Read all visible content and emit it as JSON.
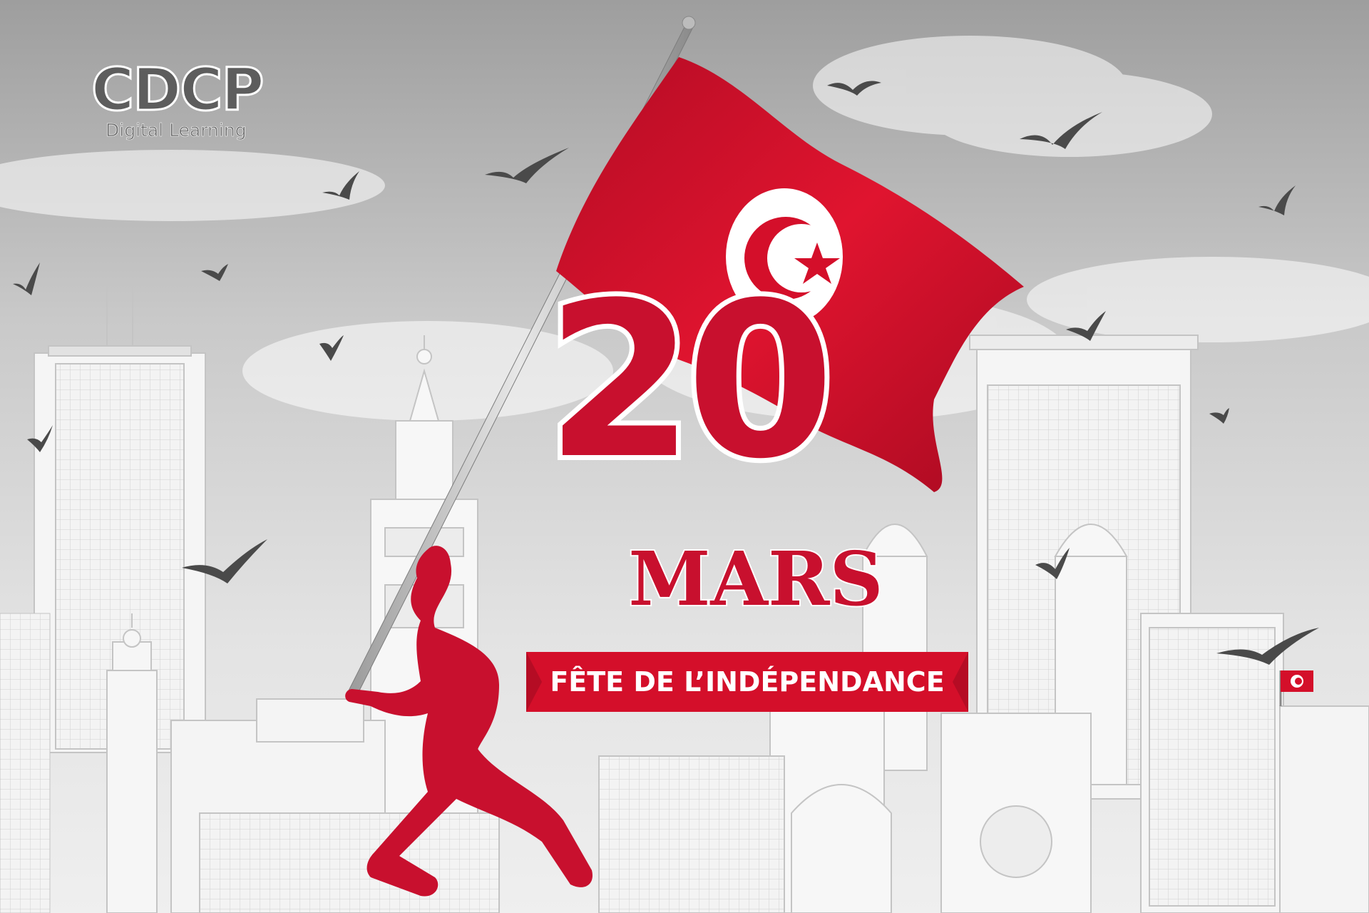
{
  "logo": {
    "name": "CDCP",
    "tagline": "Digital Learning"
  },
  "headline": {
    "day": "20",
    "month": "MARS",
    "banner": "FÊTE DE L’INDÉPENDANCE"
  },
  "colors": {
    "brand_red": "#c8102e",
    "banner_red": "#d40f2a",
    "sky": "#cfcfcf",
    "building": "#f4f4f4",
    "bird": "#4a4a4a"
  },
  "icons": [
    "flag-icon",
    "crescent-star-icon",
    "bird-icon"
  ]
}
